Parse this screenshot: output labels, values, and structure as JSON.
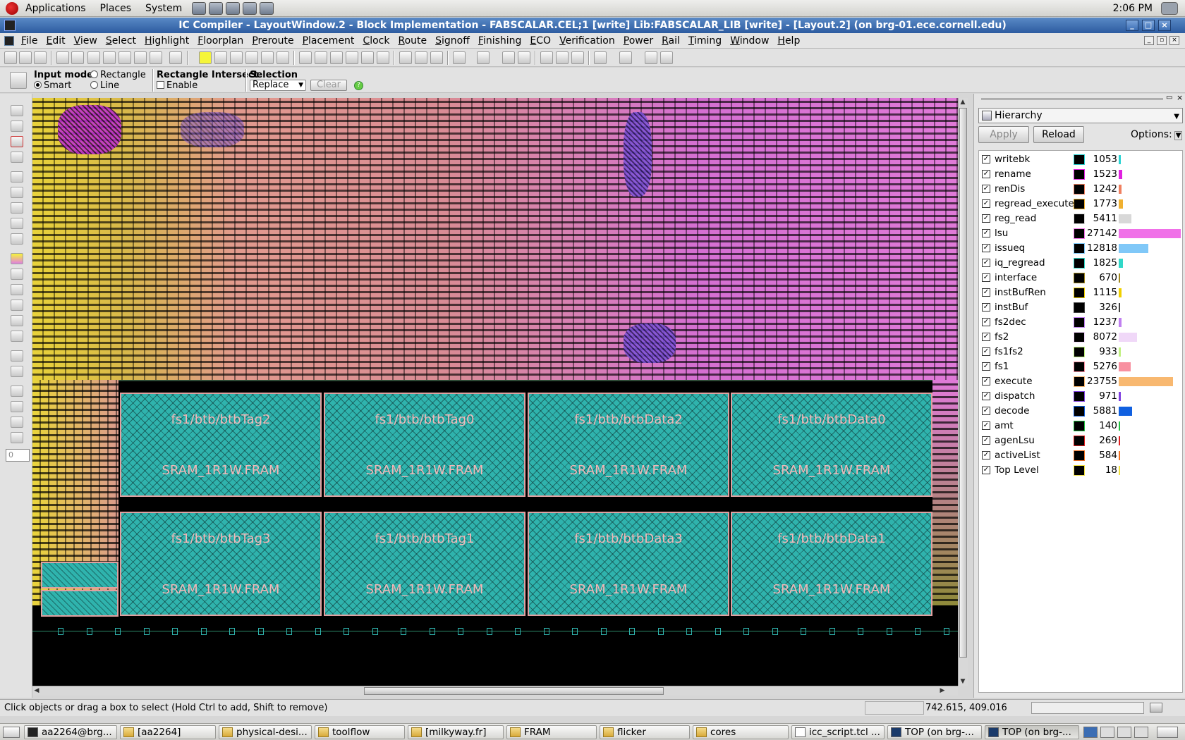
{
  "top_panel": {
    "menus": [
      "Applications",
      "Places",
      "System"
    ],
    "clock": "2:06 PM"
  },
  "window": {
    "title": "IC Compiler - LayoutWindow.2 - Block Implementation - FABSCALAR.CEL;1 [write]     Lib:FABSCALAR_LIB [write] - [Layout.2] (on brg-01.ece.cornell.edu)"
  },
  "menubar": [
    "File",
    "Edit",
    "View",
    "Select",
    "Highlight",
    "Floorplan",
    "Preroute",
    "Placement",
    "Clock",
    "Route",
    "Signoff",
    "Finishing",
    "ECO",
    "Verification",
    "Power",
    "Rail",
    "Timing",
    "Window",
    "Help"
  ],
  "options": {
    "input_mode_label": "Input mode",
    "smart": "Smart",
    "rectangle": "Rectangle",
    "line": "Line",
    "rect_intersect_label": "Rectangle Intersect",
    "enable": "Enable",
    "selection_label": "Selection",
    "selection_value": "Replace",
    "clear": "Clear",
    "layer_number": "0"
  },
  "macros": [
    {
      "inst": "fs1/btb/btbTag2",
      "ref": "SRAM_1R1W.FRAM"
    },
    {
      "inst": "fs1/btb/btbTag0",
      "ref": "SRAM_1R1W.FRAM"
    },
    {
      "inst": "fs1/btb/btbData2",
      "ref": "SRAM_1R1W.FRAM"
    },
    {
      "inst": "fs1/btb/btbData0",
      "ref": "SRAM_1R1W.FRAM"
    },
    {
      "inst": "fs1/btb/btbTag3",
      "ref": "SRAM_1R1W.FRAM"
    },
    {
      "inst": "fs1/btb/btbTag1",
      "ref": "SRAM_1R1W.FRAM"
    },
    {
      "inst": "fs1/btb/btbData3",
      "ref": "SRAM_1R1W.FRAM"
    },
    {
      "inst": "fs1/btb/btbData1",
      "ref": "SRAM_1R1W.FRAM"
    }
  ],
  "hierarchy_panel": {
    "view": "Hierarchy",
    "apply": "Apply",
    "reload": "Reload",
    "options": "Options:",
    "max_count": 27142,
    "items": [
      {
        "name": "writebk",
        "count": 1053,
        "color": "#2ad4d4"
      },
      {
        "name": "rename",
        "count": 1523,
        "color": "#e020e0"
      },
      {
        "name": "renDis",
        "count": 1242,
        "color": "#f08060"
      },
      {
        "name": "regread_execute",
        "count": 1773,
        "color": "#f0b030"
      },
      {
        "name": "reg_read",
        "count": 5411,
        "color": "#d8d8d8"
      },
      {
        "name": "lsu",
        "count": 27142,
        "color": "#f070e8"
      },
      {
        "name": "issueq",
        "count": 12818,
        "color": "#80c8f8"
      },
      {
        "name": "iq_regread",
        "count": 1825,
        "color": "#30d8c8"
      },
      {
        "name": "interface",
        "count": 670,
        "color": "#a08820"
      },
      {
        "name": "instBufRen",
        "count": 1115,
        "color": "#f0d000"
      },
      {
        "name": "instBuf",
        "count": 326,
        "color": "#404040"
      },
      {
        "name": "fs2dec",
        "count": 1237,
        "color": "#c080f0"
      },
      {
        "name": "fs2",
        "count": 8072,
        "color": "#f0d8f8"
      },
      {
        "name": "fs1fs2",
        "count": 933,
        "color": "#c0f080"
      },
      {
        "name": "fs1",
        "count": 5276,
        "color": "#f890a0"
      },
      {
        "name": "execute",
        "count": 23755,
        "color": "#f8b870"
      },
      {
        "name": "dispatch",
        "count": 971,
        "color": "#8040e0"
      },
      {
        "name": "decode",
        "count": 5881,
        "color": "#1060e0"
      },
      {
        "name": "amt",
        "count": 140,
        "color": "#20c040"
      },
      {
        "name": "agenLsu",
        "count": 269,
        "color": "#e02020"
      },
      {
        "name": "activeList",
        "count": 584,
        "color": "#f07020"
      },
      {
        "name": "Top Level",
        "count": 18,
        "color": "#f0e040"
      }
    ]
  },
  "status": {
    "message": "Click objects or drag a box to select (Hold Ctrl to add, Shift to remove)",
    "coords": "742.615, 409.016"
  },
  "taskbar": [
    {
      "label": "aa2264@brg...",
      "icon": "term"
    },
    {
      "label": "[aa2264]",
      "icon": "folder"
    },
    {
      "label": "physical-desi...",
      "icon": "folder"
    },
    {
      "label": "toolflow",
      "icon": "folder"
    },
    {
      "label": "[milkyway.fr]",
      "icon": "folder"
    },
    {
      "label": "FRAM",
      "icon": "folder"
    },
    {
      "label": "flicker",
      "icon": "folder"
    },
    {
      "label": "cores",
      "icon": "folder"
    },
    {
      "label": "icc_script.tcl ...",
      "icon": "txt"
    },
    {
      "label": "TOP (on brg-...",
      "icon": "icc"
    },
    {
      "label": "TOP (on brg-...",
      "icon": "icc"
    }
  ]
}
